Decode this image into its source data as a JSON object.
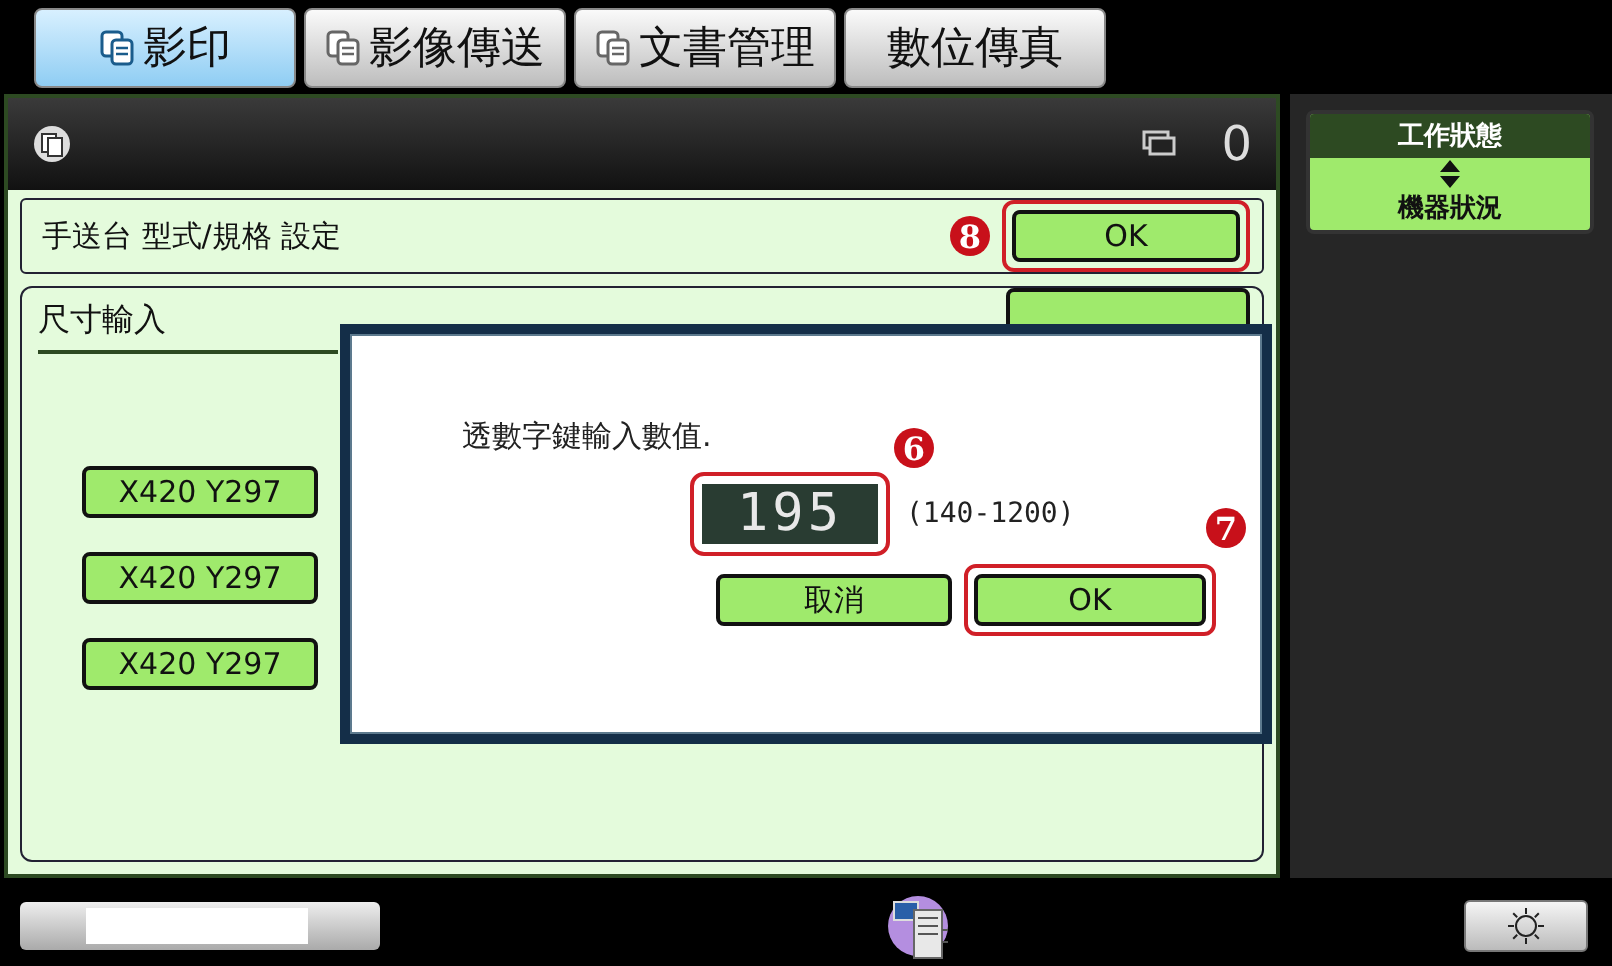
{
  "tabs": [
    {
      "label": "影印",
      "selected": true,
      "icon": true
    },
    {
      "label": "影像傳送",
      "selected": false,
      "icon": true
    },
    {
      "label": "文書管理",
      "selected": false,
      "icon": true
    },
    {
      "label": "數位傳真",
      "selected": false,
      "icon": false
    }
  ],
  "header": {
    "count": "0"
  },
  "status_button": {
    "top": "工作狀態",
    "bottom": "機器狀況"
  },
  "settings_row": {
    "label": "手送台 型式/規格 設定",
    "button": "OK",
    "marker": "8"
  },
  "size_panel": {
    "title": "尺寸輸入",
    "presets": [
      "X420 Y297",
      "X420 Y297",
      "X420 Y297"
    ]
  },
  "dialog": {
    "message": "透數字鍵輸入數值.",
    "value": "195",
    "value_marker": "6",
    "range": "(140-1200)",
    "cancel": "取消",
    "ok": "OK",
    "ok_marker": "7"
  }
}
